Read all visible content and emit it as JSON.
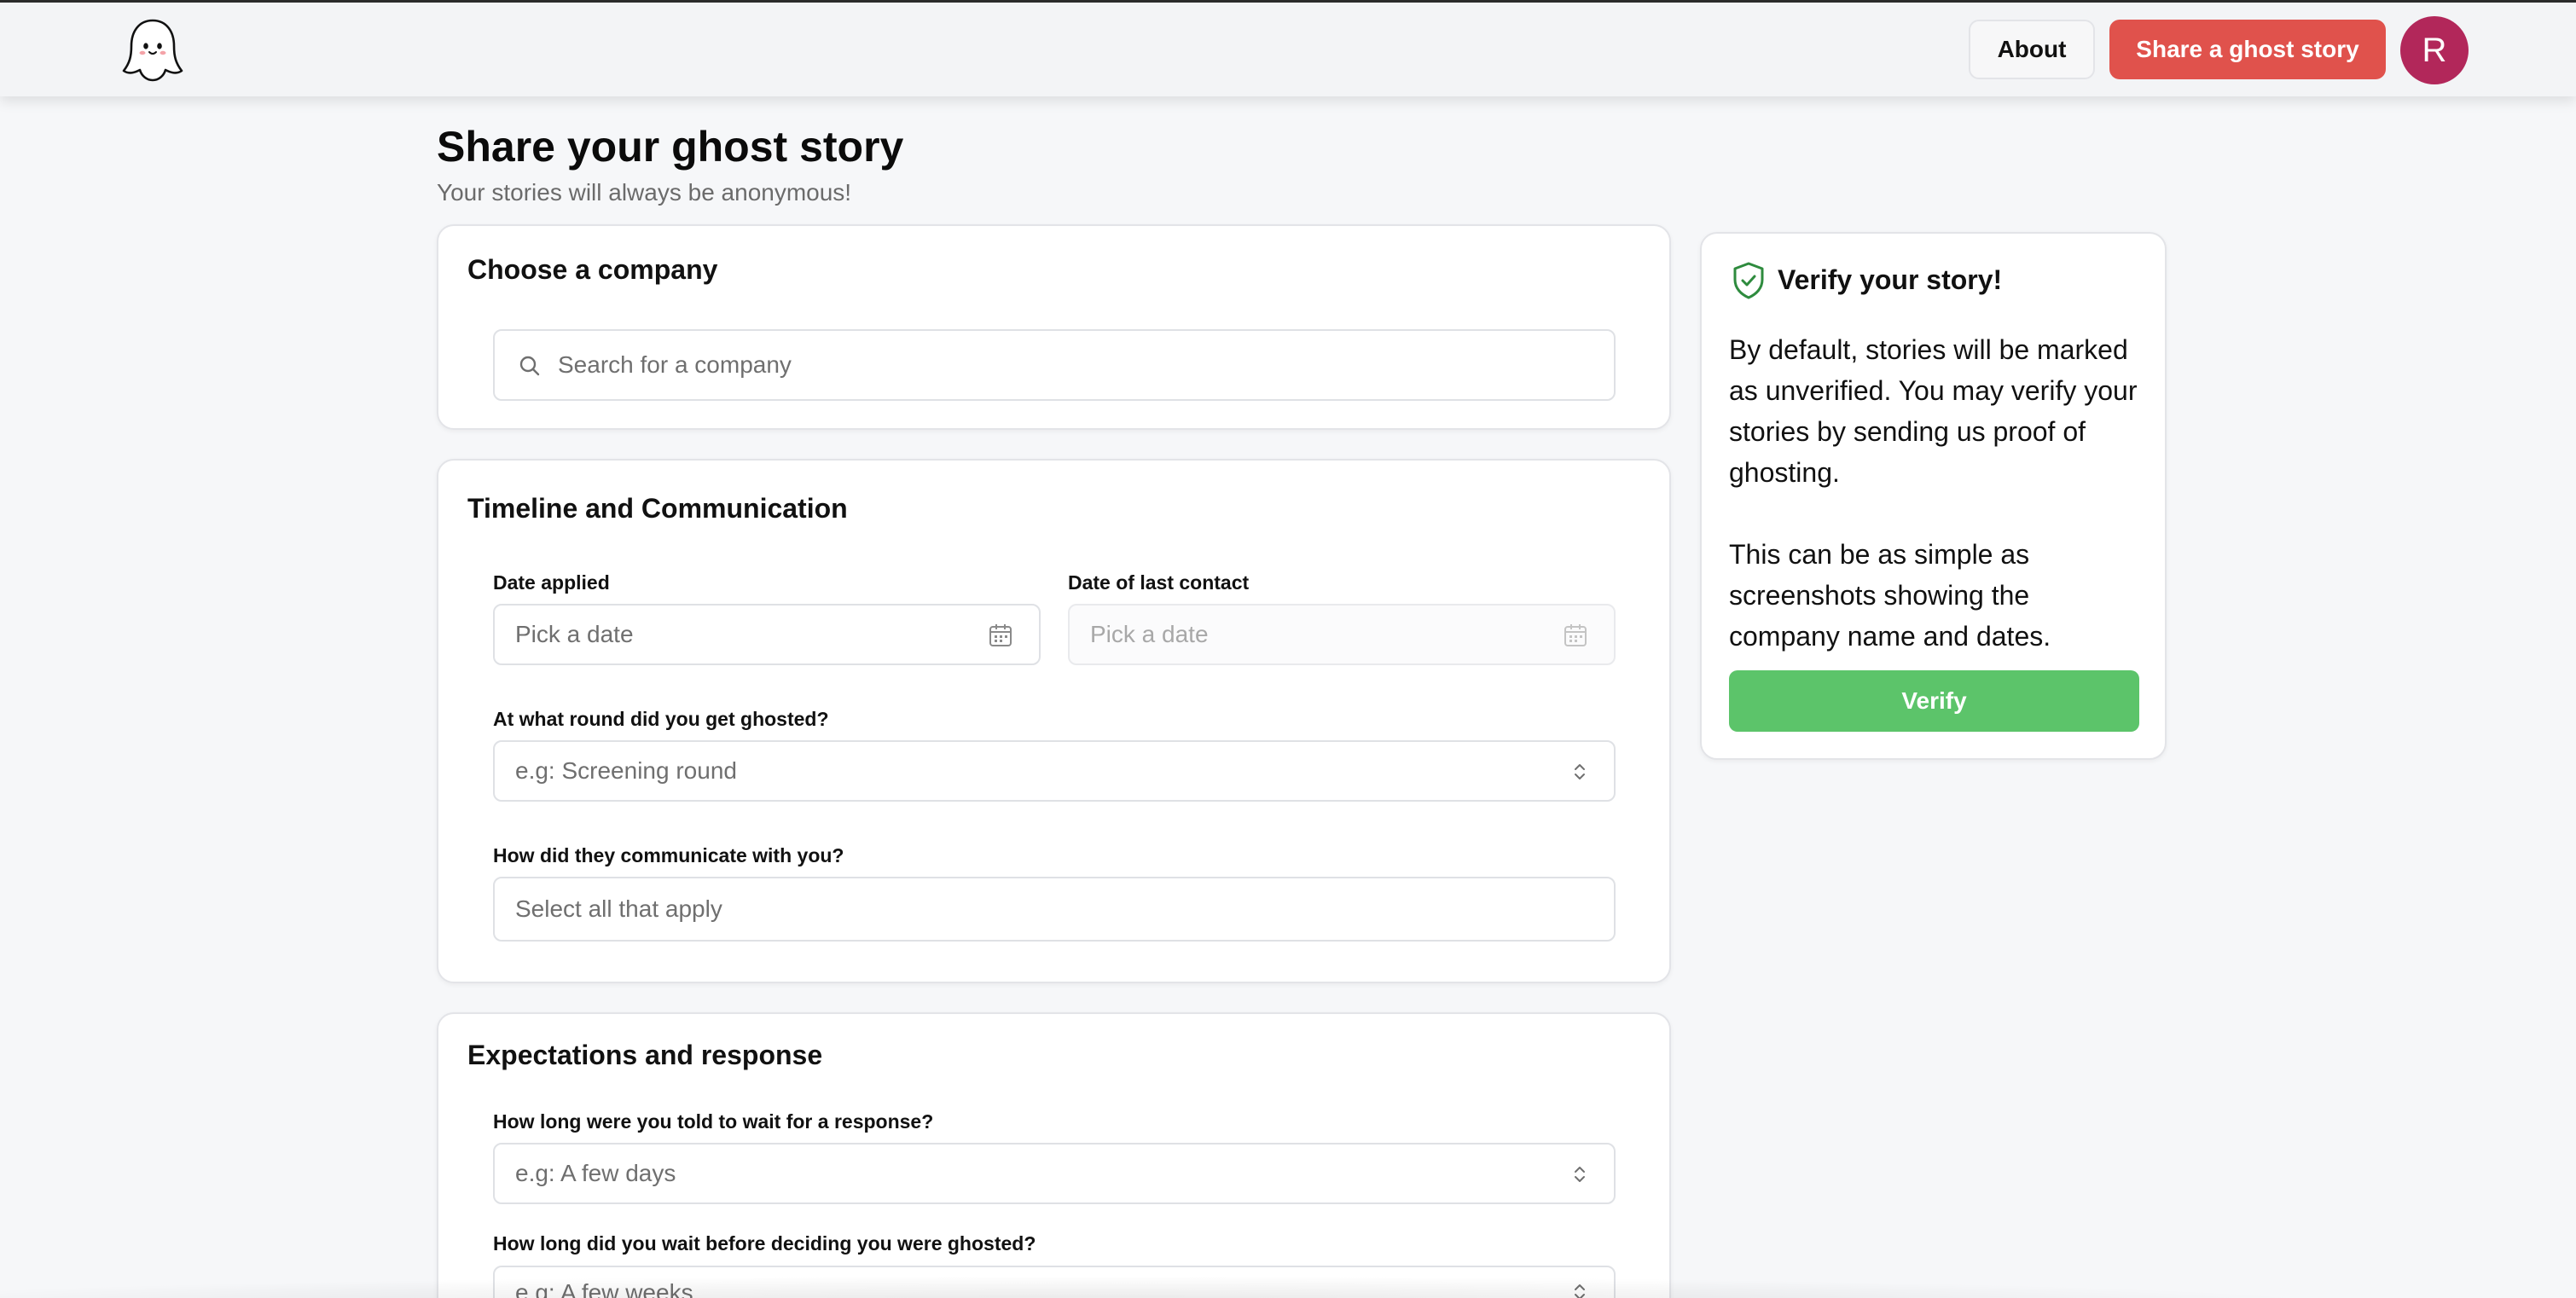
{
  "header": {
    "about_label": "About",
    "share_label": "Share a ghost story",
    "avatar_initial": "R",
    "logo_icon": "ghost-icon"
  },
  "page": {
    "title": "Share your ghost story",
    "subtitle": "Your stories will always be anonymous!"
  },
  "company_section": {
    "title": "Choose a company",
    "search_placeholder": "Search for a company",
    "search_icon": "search-icon"
  },
  "timeline_section": {
    "title": "Timeline and Communication",
    "date_applied_label": "Date applied",
    "date_applied_placeholder": "Pick a date",
    "last_contact_label": "Date of last contact",
    "last_contact_placeholder": "Pick a date",
    "round_label": "At what round did you get ghosted?",
    "round_placeholder": "e.g: Screening round",
    "communication_label": "How did they communicate with you?",
    "communication_placeholder": "Select all that apply"
  },
  "expectations_section": {
    "title": "Expectations and response",
    "wait_told_label": "How long were you told to wait for a response?",
    "wait_told_placeholder": "e.g: A few days",
    "wait_actual_label": "How long did you wait before deciding you were ghosted?",
    "wait_actual_placeholder": "e.g: A few weeks"
  },
  "verify": {
    "title": "Verify your story!",
    "paragraph_1": "By default, stories will be marked as unverified. You may verify your stories by sending us proof of ghosting.",
    "paragraph_2": "This can be as simple as screenshots showing the company name and dates.",
    "button_label": "Verify",
    "icon": "shield-check-icon"
  },
  "colors": {
    "share_button": "#e0524c",
    "verify_button": "#5cc46a",
    "avatar": "#b2275a",
    "shield": "#2e8b3e"
  }
}
